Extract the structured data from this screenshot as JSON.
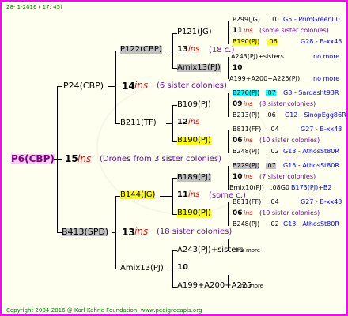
{
  "header": {
    "date": "28- 1-2016 ( 17: 45)"
  },
  "root": {
    "name": "P6(CBP)",
    "num": "15",
    "ins": "ins",
    "note": "(Drones from 3 sister colonies)"
  },
  "gen1": [
    {
      "name": "P24(CBP)",
      "num": "14",
      "ins": "ins",
      "note": "(6 sister colonies)"
    },
    {
      "name": "B413(SPD)",
      "num": "13",
      "ins": "ins",
      "note": "(18 sister colonies)"
    }
  ],
  "gen2": [
    {
      "name": "P122(CBP)",
      "num": "13",
      "ins": "ins",
      "note": "(18 c.)"
    },
    {
      "name": "B211(TF)",
      "num": "12",
      "ins": "ins",
      "note": ""
    },
    {
      "name": "B144(JG)",
      "num": "11",
      "ins": "ins",
      "note": "(some c.)"
    },
    {
      "name": "Amix13(PJ)",
      "num": "10",
      "ins": "",
      "note": ""
    }
  ],
  "gen3": [
    {
      "name": "P121(JG)"
    },
    {
      "name": "Amix13(PJ)"
    },
    {
      "name": "B109(PJ)"
    },
    {
      "name": "B190(PJ)"
    },
    {
      "name": "B189(PJ)"
    },
    {
      "name": "B190(PJ)"
    },
    {
      "name": "A243(PJ)+sisters"
    },
    {
      "name": "A199+A200+A225"
    }
  ],
  "gen4": [
    {
      "name": "P299(JG)",
      "val": ".10",
      "ref": "G5 - PrimGreen00"
    },
    {
      "name": "11",
      "ins": "ins",
      "note": "(some sister colonies)"
    },
    {
      "name": "B190(PJ)",
      "val": ".06",
      "ref": "G28 - B-xx43"
    },
    {
      "name": "A243(PJ)+sisters",
      "val": "",
      "ref": "no more"
    },
    {
      "name": "10",
      "ins": "",
      "note": ""
    },
    {
      "name": "A199+A200+A225(PJ)",
      "val": "",
      "ref": "no more"
    },
    {
      "name": "B276(PJ)",
      "val": ".07",
      "ref": "G8 - Sardasht93R"
    },
    {
      "name": "09",
      "ins": "ins",
      "note": "(8 sister colonies)"
    },
    {
      "name": "B213(PJ)",
      "val": ".06",
      "ref": "G12 - SinopEgg86R"
    },
    {
      "name": "B811(FF)",
      "val": ".04",
      "ref": "G27 - B-xx43"
    },
    {
      "name": "06",
      "ins": "ins",
      "note": "(10 sister colonies)"
    },
    {
      "name": "B248(PJ)",
      "val": ".02",
      "ref": "G13 - AthosSt80R"
    },
    {
      "name": "B229(PJ)",
      "val": ".07",
      "ref": "G15 - AthosSt80R"
    },
    {
      "name": "10",
      "ins": "ins",
      "note": "(7 sister colonies)"
    },
    {
      "name": "Bmix10(PJ)",
      "val": ".08G0",
      "ref": "B173(PJ)+B2"
    },
    {
      "name": "B811(FF)",
      "val": ".04",
      "ref": "G27 - B-xx43"
    },
    {
      "name": "06",
      "ins": "ins",
      "note": "(10 sister colonies)"
    },
    {
      "name": "B248(PJ)",
      "val": ".02",
      "ref": "G13 - AthosSt80R"
    },
    {
      "name": "A243(PJ)+sisters",
      "val": "",
      "ref": "no more"
    },
    {
      "name": "A199+A200+A225",
      "val": "",
      "ref": "no more"
    }
  ],
  "footer": {
    "copyright": "Copyright 2004-2016 @ Karl Kehrle Foundation.   www.pedigreeapis.org"
  }
}
